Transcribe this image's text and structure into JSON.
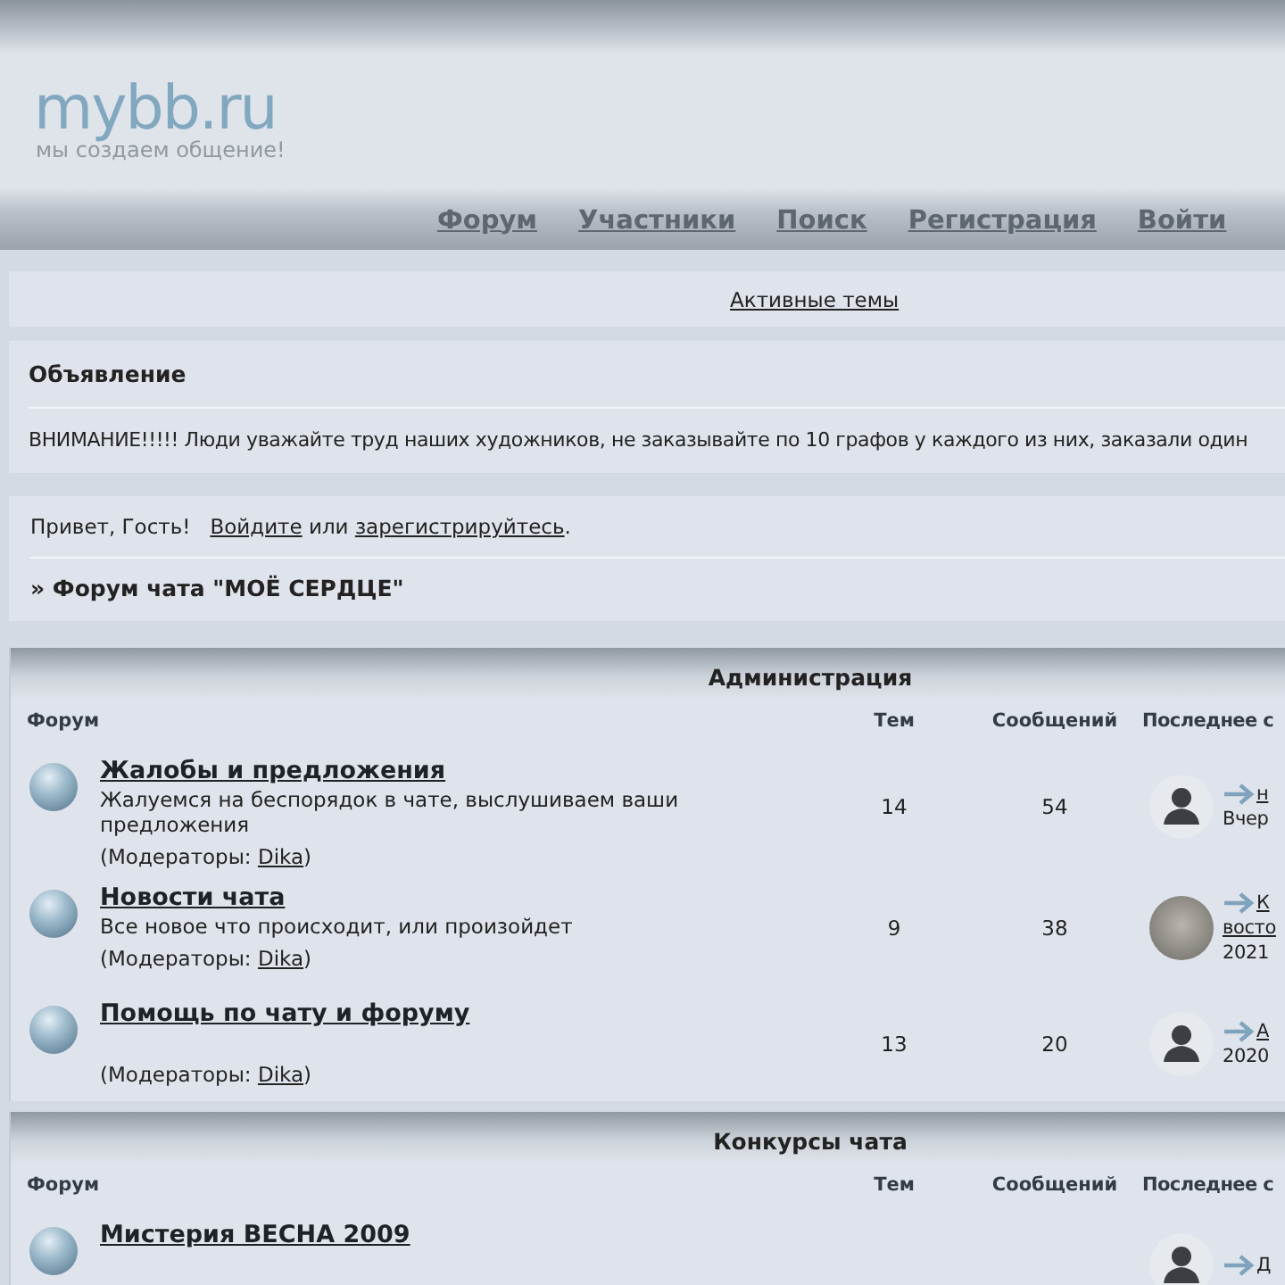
{
  "header": {
    "logo": "mybb.ru",
    "tagline": "мы создаем общение!",
    "nav": [
      "Форум",
      "Участники",
      "Поиск",
      "Регистрация",
      "Войти"
    ]
  },
  "active_topics_link": "Активные темы",
  "announcement": {
    "title": "Объявление",
    "text": "ВНИМАНИЕ!!!!! Люди уважайте труд наших художников, не заказывайте по 10 графов у каждого из них, заказали один"
  },
  "welcome": {
    "greeting": "Привет, Гость!",
    "login_link": "Войдите",
    "or": "или",
    "register_link": "зарегистрируйтесь",
    "end": "."
  },
  "crumb": "» Форум чата \"МОЁ СЕРДЦЕ\"",
  "categories": [
    {
      "title": "Администрация",
      "columns": [
        "Форум",
        "Тем",
        "Сообщений",
        "Последнее с"
      ],
      "forums": [
        {
          "name": "Жалобы и предложения",
          "description": "Жалуемся на беспорядок в чате, выслушиваем ваши предложения",
          "moderators_prefix": "(Модераторы: ",
          "moderator": "Dika",
          "moderators_suffix": ")",
          "topics": "14",
          "posts": "54",
          "last_post": {
            "avatar": {
              "kind": "silhouette"
            },
            "topic": [
              "н"
            ],
            "date": "Вчер"
          }
        },
        {
          "name": "Новости чата",
          "description": "Все новое что происходит, или произойдет",
          "moderators_prefix": "(Модераторы: ",
          "moderator": "Dika",
          "moderators_suffix": ")",
          "topics": "9",
          "posts": "38",
          "last_post": {
            "avatar": {
              "kind": "photo"
            },
            "topic": [
              "К",
              "восто"
            ],
            "date": "2021"
          }
        },
        {
          "name": "Помощь по чату и форуму",
          "moderators_prefix": "(Модераторы: ",
          "moderator": "Dika",
          "moderators_suffix": ")",
          "topics": "13",
          "posts": "20",
          "last_post": {
            "avatar": {
              "kind": "silhouette"
            },
            "topic": [
              "А"
            ],
            "date": "2020"
          }
        }
      ]
    },
    {
      "title": "Конкурсы чата",
      "columns": [
        "Форум",
        "Тем",
        "Сообщений",
        "Последнее с"
      ],
      "forums": [
        {
          "name": "Мистерия ВЕСНА 2009",
          "last_post": {
            "avatar": {
              "kind": "silhouette"
            },
            "topic": [
              "Д"
            ]
          }
        }
      ]
    }
  ]
}
